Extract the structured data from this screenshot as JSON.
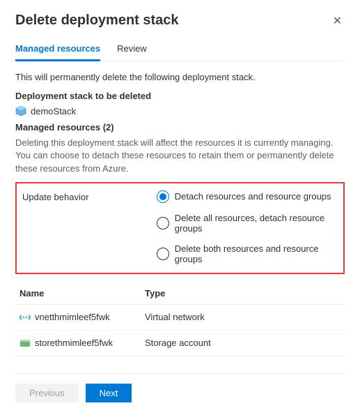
{
  "header": {
    "title": "Delete deployment stack"
  },
  "tabs": {
    "managed": "Managed resources",
    "review": "Review"
  },
  "intro": "This will permanently delete the following deployment stack.",
  "stack_label": "Deployment stack to be deleted",
  "stack_name": "demoStack",
  "managed_heading": "Managed resources (2)",
  "managed_help": "Deleting this deployment stack will affect the resources it is currently managing. You can choose to detach these resources to retain them or permanently delete these resources from Azure.",
  "behavior": {
    "label": "Update behavior",
    "options": [
      "Detach resources and resource groups",
      "Delete all resources, detach resource groups",
      "Delete both resources and resource groups"
    ]
  },
  "table": {
    "col_name": "Name",
    "col_type": "Type",
    "rows": [
      {
        "name": "vnetthmimleef5fwk",
        "type": "Virtual network"
      },
      {
        "name": "storethmimleef5fwk",
        "type": "Storage account"
      }
    ]
  },
  "footer": {
    "previous": "Previous",
    "next": "Next"
  }
}
